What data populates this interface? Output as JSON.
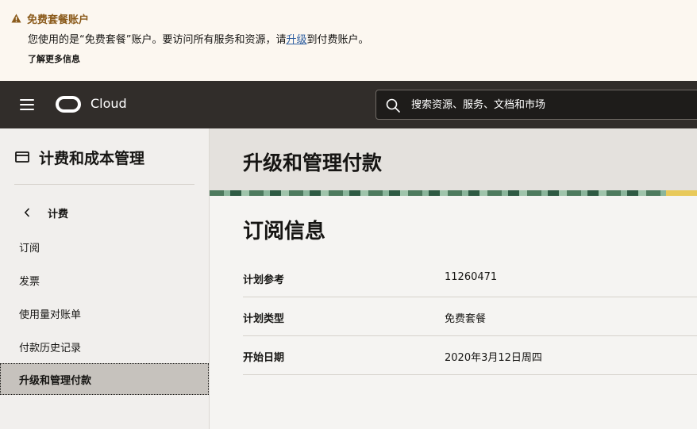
{
  "banner": {
    "title": "免费套餐账户",
    "message_before": "您使用的是“免费套餐”账户。要访问所有服务和资源，请",
    "link": "升级",
    "message_after": "到付费账户。",
    "more": "了解更多信息"
  },
  "header": {
    "brand": "Cloud",
    "search_placeholder": "搜索资源、服务、文档和市场"
  },
  "sidebar": {
    "title": "计费和成本管理",
    "back_label": "计费",
    "items": [
      {
        "label": "订阅"
      },
      {
        "label": "发票"
      },
      {
        "label": "使用量对账单"
      },
      {
        "label": "付款历史记录"
      },
      {
        "label": "升级和管理付款"
      }
    ]
  },
  "page": {
    "title": "升级和管理付款",
    "section_title": "订阅信息",
    "rows": [
      {
        "label": "计划参考",
        "value": "11260471"
      },
      {
        "label": "计划类型",
        "value": "免费套餐"
      },
      {
        "label": "开始日期",
        "value": "2020年3月12日周四"
      }
    ]
  },
  "colors": {
    "topbar": "#312d2a",
    "banner_bg": "#fcf7f0",
    "warning": "#8a5a1a",
    "link": "#2f5fa0",
    "active_nav": "#c6c2bd"
  }
}
